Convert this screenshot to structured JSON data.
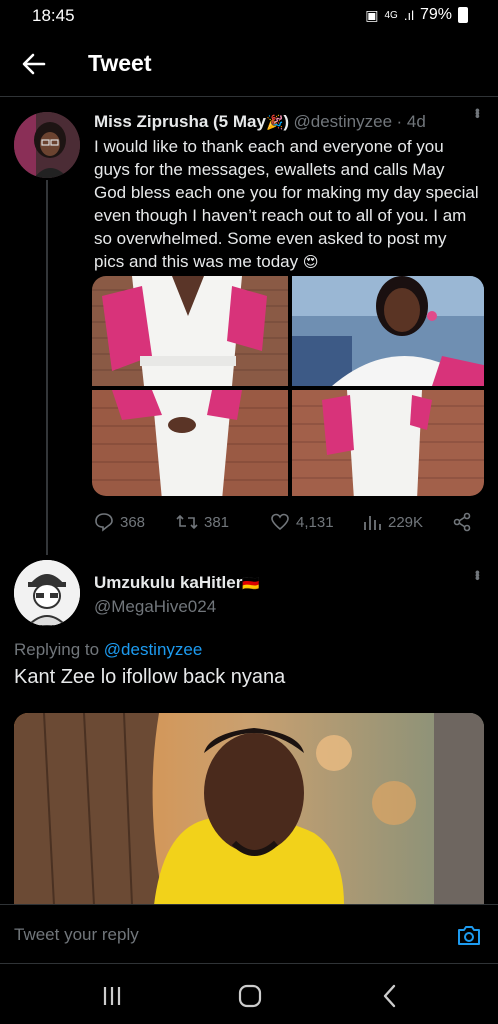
{
  "status": {
    "time": "18:45",
    "battery": "79%",
    "network": "4G"
  },
  "header": {
    "title": "Tweet"
  },
  "tweet": {
    "name": "Miss Ziprusha (5 May",
    "name_suffix": ")",
    "name_emoji": "🎉",
    "handle": "@destinyzee",
    "time": "· 4d",
    "text": "I would like to thank each and everyone of you guys for the messages, ewallets and calls May God bless each one you for making my day special even though I haven’t reach out to all of you. I am so overwhelmed. Some even asked to post my pics and this was me today",
    "text_emoji": "😍",
    "stats": {
      "replies": "368",
      "retweets": "381",
      "likes": "4,131",
      "views": "229K"
    }
  },
  "reply": {
    "name": "Umzukulu kaHitler",
    "flag": "🇩🇪",
    "handle": "@MegaHive024",
    "replying_label": "Replying to",
    "replying_to": "@destinyzee",
    "text": "Kant Zee lo ifollow back nyana"
  },
  "composer": {
    "placeholder": "Tweet your reply"
  },
  "colors": {
    "accent": "#1d9bf0",
    "background": "#000000",
    "muted": "#71767b"
  }
}
